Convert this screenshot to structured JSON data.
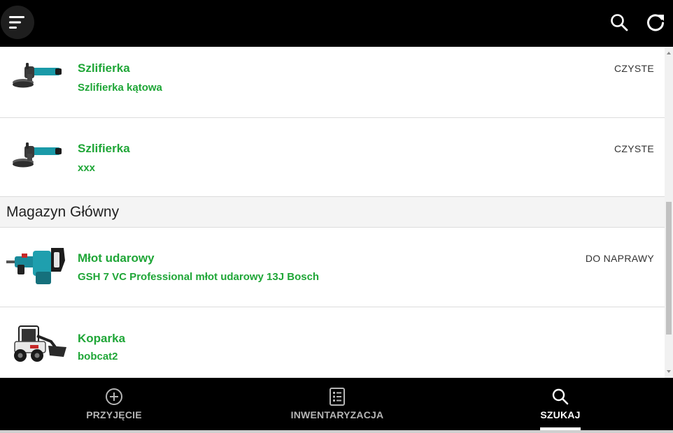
{
  "header": {
    "menu_icon": "menu-icon",
    "search_icon": "search-icon",
    "refresh_icon": "refresh-icon"
  },
  "list": {
    "items_top": [
      {
        "title": "Szlifierka",
        "subtitle": "Szlifierka kątowa",
        "status": "CZYSTE",
        "image": "angle-grinder-image"
      },
      {
        "title": "Szlifierka",
        "subtitle": "xxx",
        "status": "CZYSTE",
        "image": "angle-grinder-image"
      }
    ],
    "section": {
      "title": "Magazyn Główny"
    },
    "items_section": [
      {
        "title": "Młot udarowy",
        "subtitle": "GSH 7 VC Professional młot udarowy 13J Bosch",
        "status": "DO NAPRAWY",
        "image": "demolition-hammer-image"
      },
      {
        "title": "Koparka",
        "subtitle": "bobcat2",
        "status": "",
        "image": "skid-steer-loader-image"
      }
    ]
  },
  "bottom_nav": {
    "items": [
      {
        "label": "PRZYJĘCIE",
        "icon": "plus-circle-icon"
      },
      {
        "label": "INWENTARYZACJA",
        "icon": "checklist-icon"
      },
      {
        "label": "SZUKAJ",
        "icon": "search-icon",
        "active": true
      }
    ]
  },
  "colors": {
    "accent_green": "#1fa637",
    "bar_background": "#000000",
    "section_background": "#f4f4f4"
  }
}
